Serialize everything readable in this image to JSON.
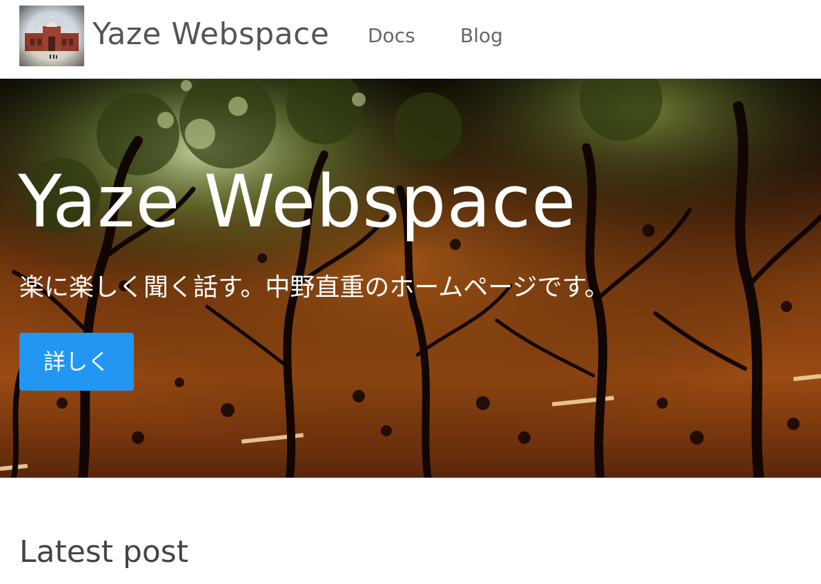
{
  "header": {
    "site_title": "Yaze Webspace",
    "nav": [
      {
        "label": "Docs"
      },
      {
        "label": "Blog"
      }
    ]
  },
  "hero": {
    "title": "Yaze Webspace",
    "subtitle": "楽に楽しく聞く話す。中野直重のホームページです。",
    "button_label": "詳しく",
    "colors": {
      "button": "#2196f3",
      "text": "#ffffff"
    }
  },
  "main": {
    "latest_post_heading": "Latest post"
  },
  "icons": {
    "logo": "mosque-photo-icon"
  }
}
